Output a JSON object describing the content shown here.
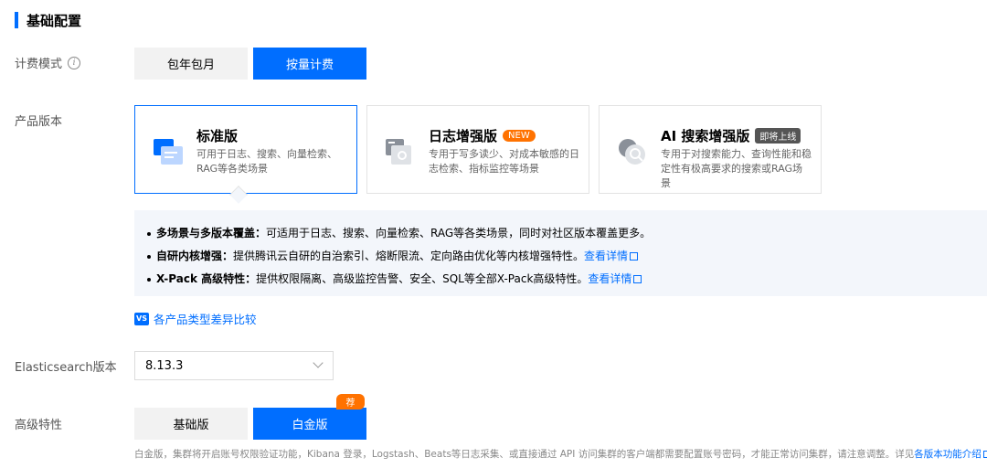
{
  "section": {
    "title": "基础配置"
  },
  "billing": {
    "label": "计费模式",
    "options": [
      "包年包月",
      "按量计费"
    ],
    "selected": "按量计费"
  },
  "edition": {
    "label": "产品版本",
    "cards": [
      {
        "title": "标准版",
        "desc": "可用于日志、搜索、向量检索、RAG等各类场景",
        "badge": "",
        "icon": "standard-edition-icon"
      },
      {
        "title": "日志增强版",
        "desc": "专用于写多读少、对成本敏感的日志检索、指标监控等场景",
        "badge": "NEW",
        "icon": "log-edition-icon"
      },
      {
        "title": "AI 搜索增强版",
        "desc": "专用于对搜索能力、查询性能和稳定性有极高要求的搜索或RAG场景",
        "badge": "即将上线",
        "icon": "ai-search-edition-icon"
      }
    ],
    "selected": "标准版",
    "features": [
      {
        "title": "多场景与多版本覆盖：",
        "text": "可适用于日志、搜索、向量检索、RAG等各类场景，同时对社区版本覆盖更多。",
        "link": ""
      },
      {
        "title": "自研内核增强：",
        "text": "提供腾讯云自研的自治索引、熔断限流、定向路由优化等内核增强特性。",
        "link": "查看详情"
      },
      {
        "title": "X-Pack 高级特性：",
        "text": "提供权限隔离、高级监控告警、安全、SQL等全部X-Pack高级特性。",
        "link": "查看详情"
      }
    ],
    "compare_link": "各产品类型差异比较",
    "compare_icon_text": "VS"
  },
  "es_version": {
    "label": "Elasticsearch版本",
    "value": "8.13.3"
  },
  "advanced": {
    "label": "高级特性",
    "options": [
      "基础版",
      "白金版"
    ],
    "selected": "白金版",
    "recommend_tag": "荐",
    "note": "白金版，集群将开启账号权限验证功能，Kibana 登录，Logstash、Beats等日志采集、或直接通过 API 访问集群的客户端都需要配置账号密码，才能正常访问集群，请注意调整。详见",
    "note_link": "各版本功能介绍"
  },
  "colors": {
    "accent": "#006eff",
    "new_badge": "#ff7200",
    "soon_badge": "#555555"
  }
}
